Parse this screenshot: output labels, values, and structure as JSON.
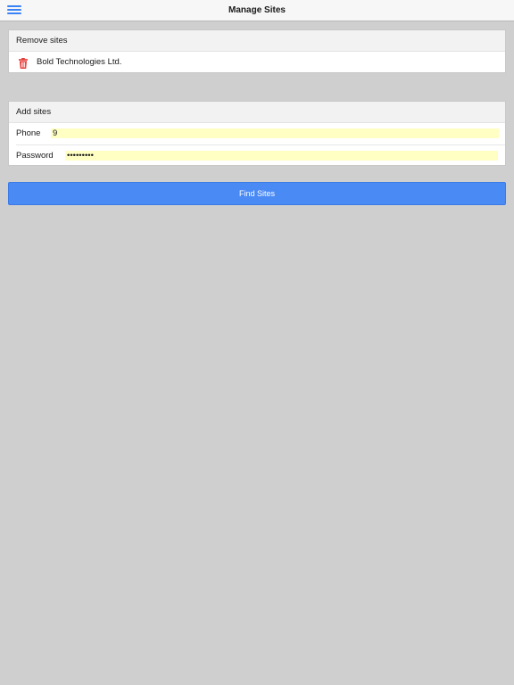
{
  "header": {
    "title": "Manage Sites",
    "menu_icon": "hamburger-menu-icon"
  },
  "remove_section": {
    "title": "Remove sites",
    "sites": [
      {
        "name": "Bold Technologies Ltd.",
        "icon": "trash-icon"
      }
    ]
  },
  "add_section": {
    "title": "Add sites",
    "phone": {
      "label": "Phone",
      "value": "9"
    },
    "password": {
      "label": "Password",
      "value": "•••••••••"
    }
  },
  "actions": {
    "find_sites_label": "Find Sites"
  },
  "colors": {
    "accent": "#4a8af5",
    "trash": "#e53935",
    "autofill": "#ffffc4",
    "background": "#cfcfcf"
  }
}
